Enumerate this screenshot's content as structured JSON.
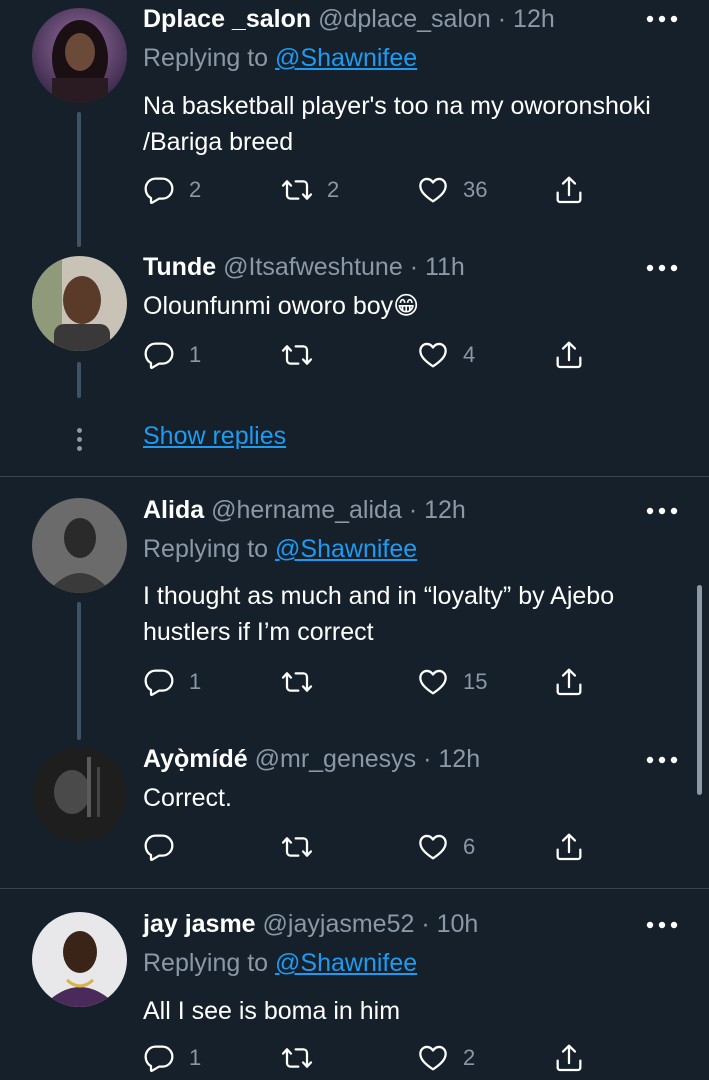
{
  "tweets": [
    {
      "name": "Dplace _salon",
      "handle": "@dplace_salon",
      "time": "· 12h",
      "reply_prefix": "Replying to ",
      "reply_to": "@Shawnifee",
      "text": "Na basketball player's too na my oworonshoki /Bariga breed",
      "replies": "2",
      "retweets": "2",
      "likes": "36"
    },
    {
      "name": "Tunde",
      "handle": "@Itsafweshtune",
      "time": "· 11h",
      "text": "Olounfunmi oworo boy😁",
      "replies": "1",
      "retweets": "",
      "likes": "4"
    },
    {
      "name": "Alida",
      "handle": "@hername_alida",
      "time": "· 12h",
      "reply_prefix": "Replying to ",
      "reply_to": "@Shawnifee",
      "text": "I thought as much and in “loyalty” by Ajebo hustlers if I’m correct",
      "replies": "1",
      "retweets": "",
      "likes": "15"
    },
    {
      "name": "Ayọ̀mídé",
      "handle": "@mr_genesys",
      "time": "· 12h",
      "text": "Correct.",
      "replies": "",
      "retweets": "",
      "likes": "6"
    },
    {
      "name": "jay jasme",
      "handle": "@jayjasme52",
      "time": "· 10h",
      "reply_prefix": "Replying to ",
      "reply_to": "@Shawnifee",
      "text": "All I see is boma in him",
      "replies": "1",
      "retweets": "",
      "likes": "2"
    }
  ],
  "show_replies": "Show replies",
  "icons": {
    "reply": "reply-icon",
    "retweet": "retweet-icon",
    "like": "heart-icon",
    "share": "share-icon",
    "more": "more-icon"
  },
  "colors": {
    "background": "#15202b",
    "text": "#ffffff",
    "secondary": "#8b98a5",
    "link": "#1d9bf0",
    "divider": "#38444d"
  }
}
